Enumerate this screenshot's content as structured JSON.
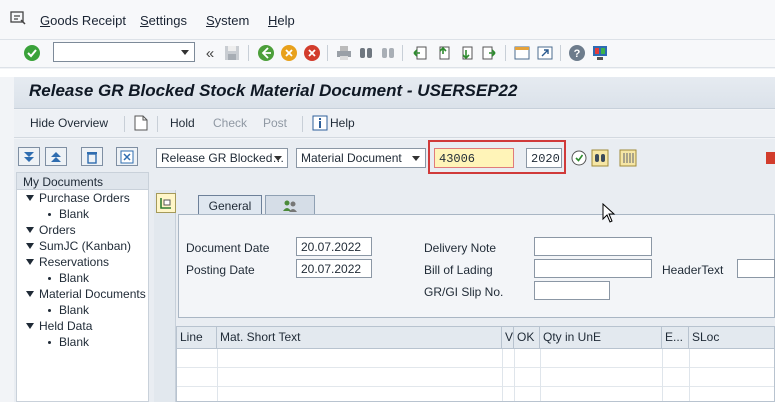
{
  "menu": {
    "items": [
      "Goods Receipt",
      "Settings",
      "System",
      "Help"
    ]
  },
  "title": "Release GR Blocked Stock Material Document - USERSEP22",
  "app_toolbar": {
    "hide_overview": "Hide Overview",
    "hold": "Hold",
    "check": "Check",
    "post": "Post",
    "help": "Help"
  },
  "sidebar": {
    "header": "My Documents",
    "items": [
      {
        "label": "Purchase Orders",
        "type": "node"
      },
      {
        "label": "Blank",
        "type": "leaf"
      },
      {
        "label": "Orders",
        "type": "node"
      },
      {
        "label": "SumJC (Kanban)",
        "type": "node"
      },
      {
        "label": "Reservations",
        "type": "node"
      },
      {
        "label": "Blank",
        "type": "leaf"
      },
      {
        "label": "Material Documents",
        "type": "node"
      },
      {
        "label": "Blank",
        "type": "leaf"
      },
      {
        "label": "Held Data",
        "type": "node"
      },
      {
        "label": "Blank",
        "type": "leaf"
      }
    ]
  },
  "selection": {
    "transaction": "Release GR Blocked…",
    "reference": "Material Document",
    "doc_number": "43006",
    "year": "2020"
  },
  "tabs": [
    "General"
  ],
  "form": {
    "document_date_label": "Document Date",
    "document_date": "20.07.2022",
    "posting_date_label": "Posting Date",
    "posting_date": "20.07.2022",
    "delivery_note_label": "Delivery Note",
    "bill_of_lading_label": "Bill of Lading",
    "header_text_label": "HeaderText",
    "slip_no_label": "GR/GI Slip No."
  },
  "table": {
    "columns": [
      "Line",
      "Mat. Short Text",
      "V",
      "OK",
      "Qty in UnE",
      "E...",
      "SLoc"
    ]
  },
  "colors": {
    "highlight": "#d03a3a",
    "doc_field_bg": "#fff4b8",
    "title_bg": "#dbe2ea"
  }
}
